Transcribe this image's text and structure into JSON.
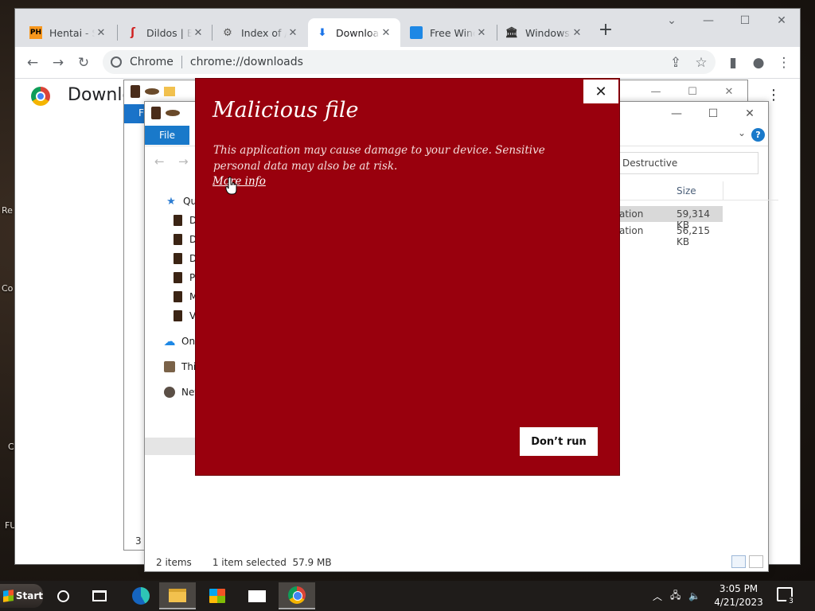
{
  "desktop": {
    "labels": [
      "Re",
      "Co",
      "C",
      "FU"
    ]
  },
  "chrome": {
    "tabs": [
      {
        "label": "Hentai - S",
        "icon": "ph-favicon"
      },
      {
        "label": "Dildos | Bl",
        "icon": "red-logo-favicon"
      },
      {
        "label": "Index of /",
        "icon": "server-favicon"
      },
      {
        "label": "Download",
        "icon": "download-icon",
        "active": true
      },
      {
        "label": "Free Wind",
        "icon": "blue-square-favicon"
      },
      {
        "label": "Windows",
        "icon": "bank-favicon"
      }
    ],
    "ph_badge": "PH",
    "new_tab": "+",
    "site_name": "Chrome",
    "url": "chrome://downloads",
    "page_title": "Downlo"
  },
  "explorer_back": {
    "file_tab": "F",
    "status_count": "3"
  },
  "explorer": {
    "file_tab": "File",
    "help": "?",
    "search_value": "Destructive",
    "size_header": "Size",
    "nav": [
      {
        "label": "Qui",
        "icon": "star-icon"
      },
      {
        "label": "De",
        "icon": "folder-icon"
      },
      {
        "label": "Do",
        "icon": "folder-icon"
      },
      {
        "label": "Do",
        "icon": "folder-icon"
      },
      {
        "label": "Pi",
        "icon": "folder-icon"
      },
      {
        "label": "M",
        "icon": "folder-icon"
      },
      {
        "label": "Vi",
        "icon": "folder-icon"
      },
      {
        "label": "One",
        "icon": "cloud-icon"
      },
      {
        "label": "Thi",
        "icon": "pc-icon"
      },
      {
        "label": "Net",
        "icon": "network-icon"
      }
    ],
    "files": [
      {
        "type": "ation",
        "size": "59,314 KB",
        "selected": true
      },
      {
        "type": "ation",
        "size": "56,215 KB",
        "selected": false
      }
    ],
    "status": {
      "items": "2 items",
      "selected": "1 item selected  57.9 MB"
    }
  },
  "smartscreen": {
    "title": "Malicious file",
    "body": "This application may cause damage to your device. Sensitive personal data may also be at risk.",
    "more_info": "More info",
    "dont_run": "Don’t run",
    "bg_color": "#99000d"
  },
  "taskbar": {
    "start_label": "Start",
    "time": "3:05 PM",
    "date": "4/21/2023",
    "notification_count": "3"
  }
}
